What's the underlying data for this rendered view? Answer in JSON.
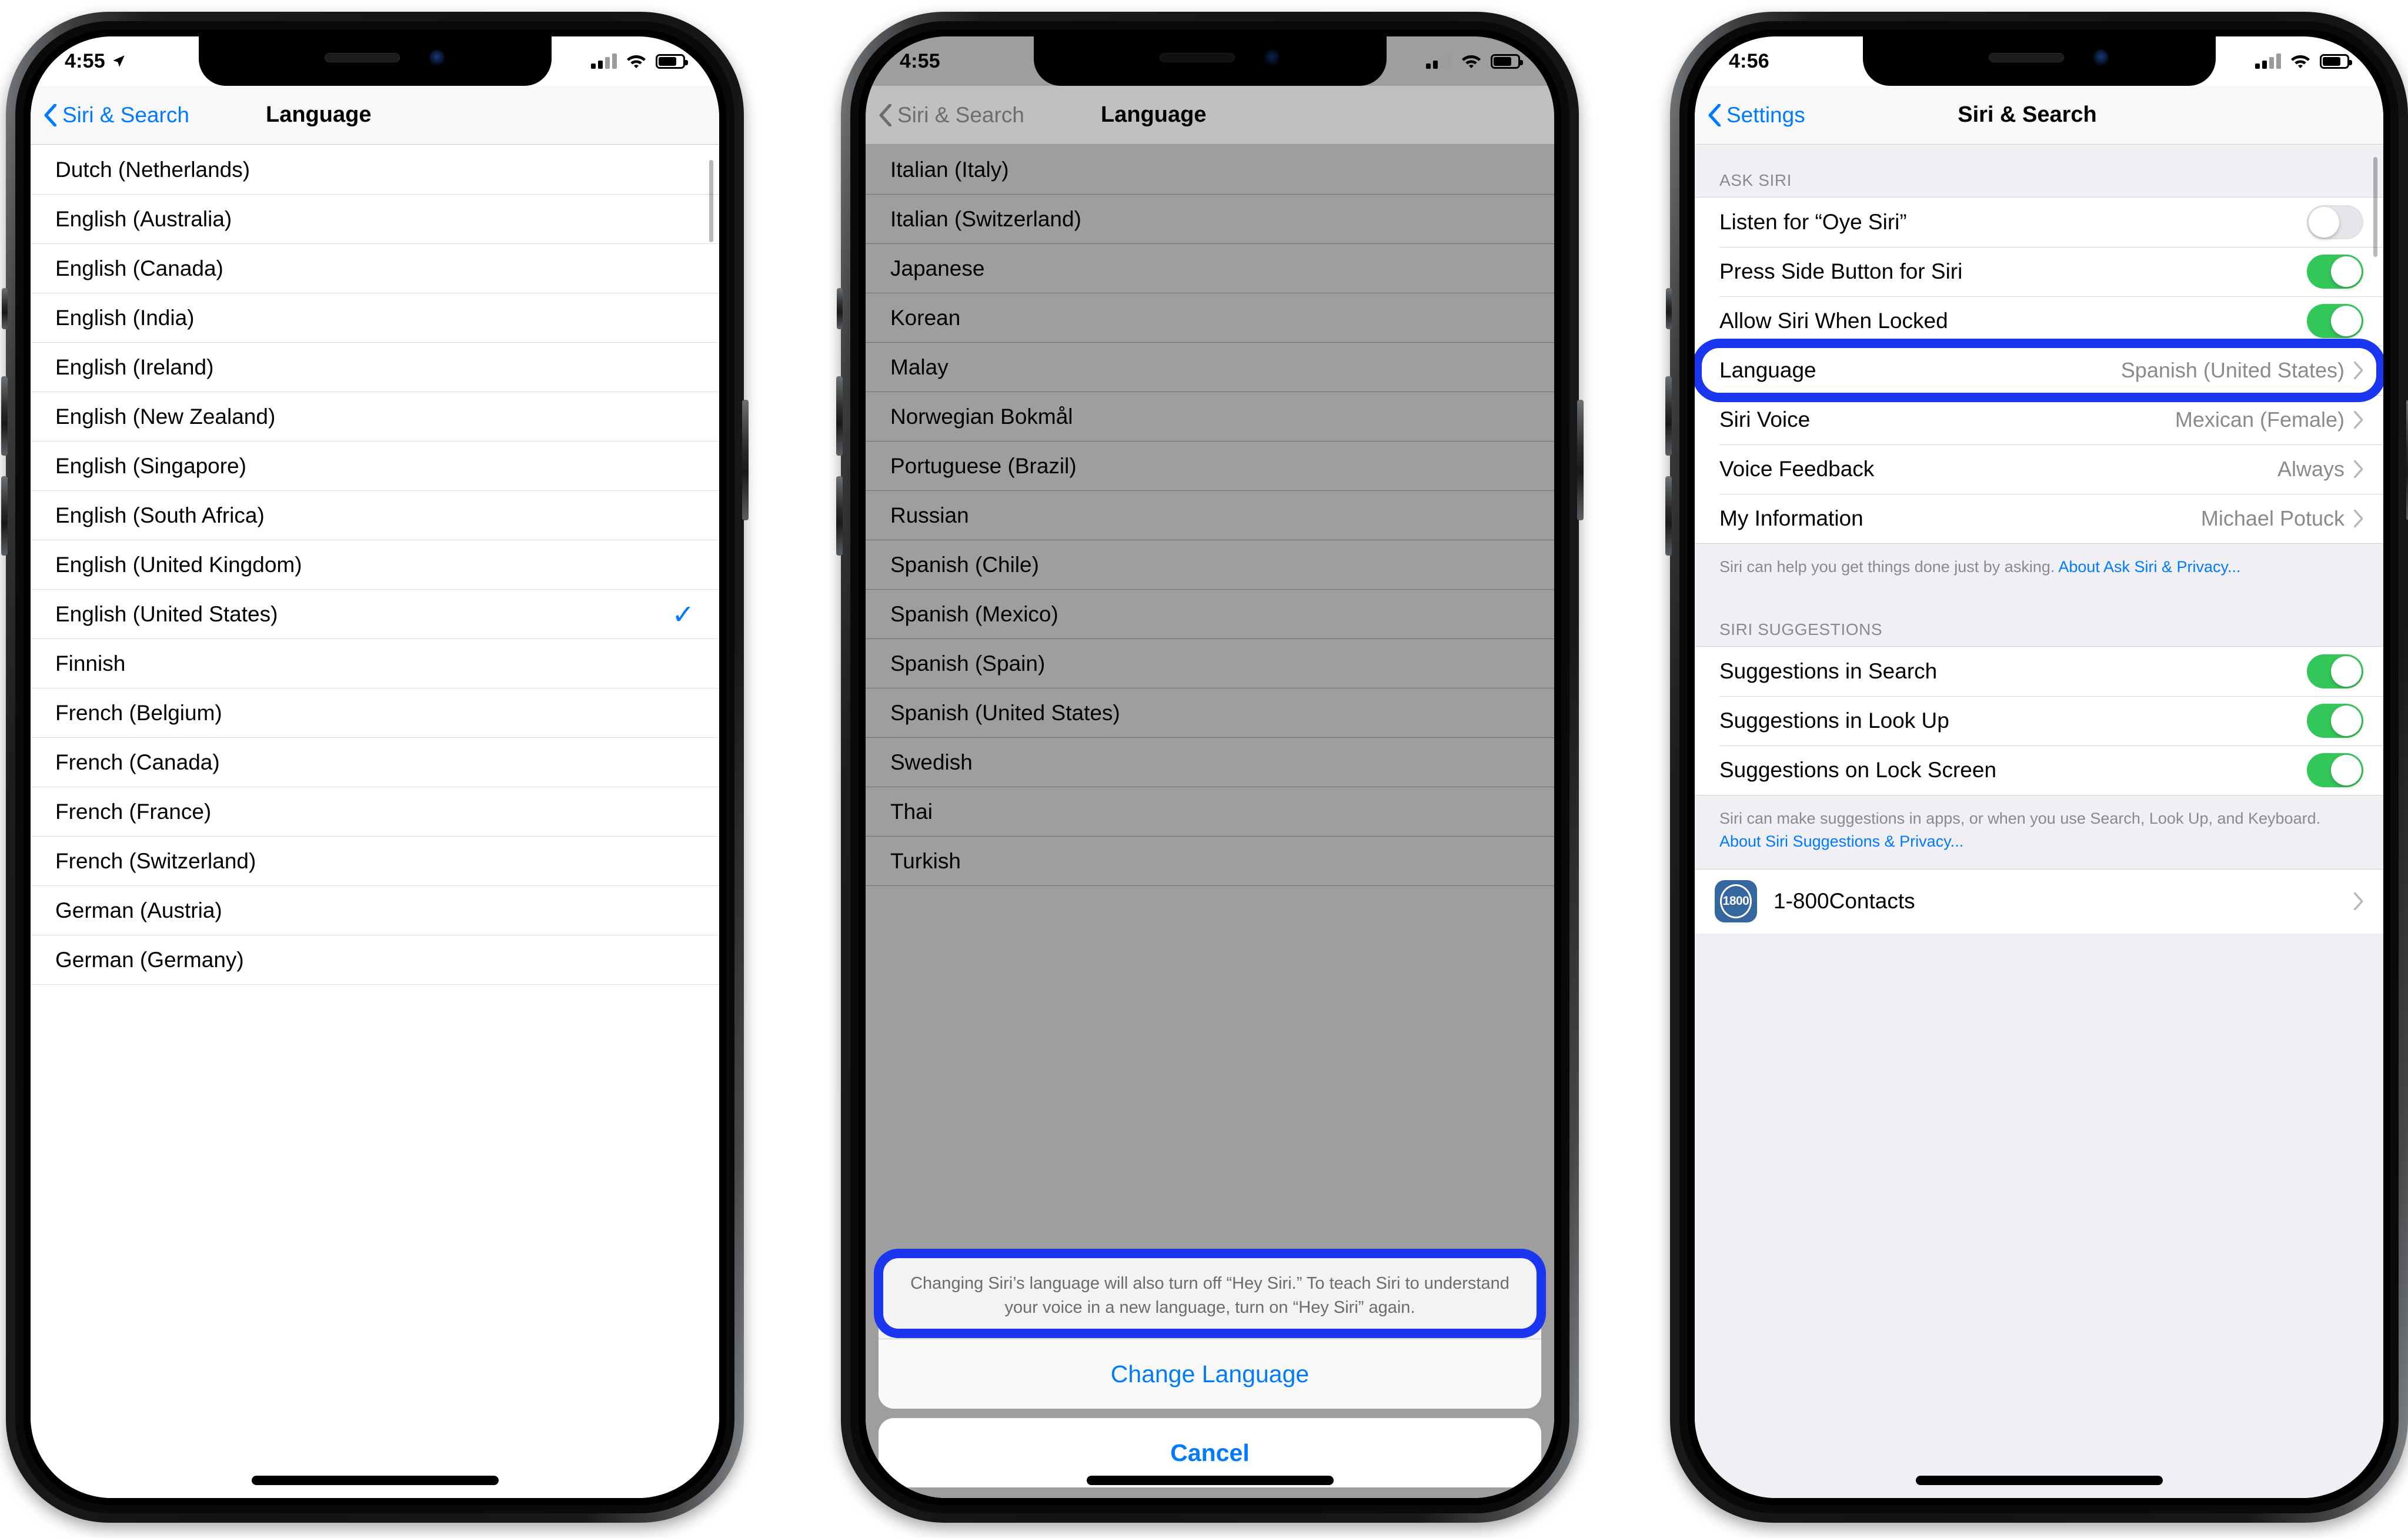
{
  "phone1": {
    "status": {
      "time": "4:55",
      "location_icon": "location-arrow-icon",
      "signal_icon": "cellular-bars-icon",
      "wifi_icon": "wifi-icon",
      "battery_icon": "battery-icon"
    },
    "nav": {
      "back_label": "Siri & Search",
      "title": "Language"
    },
    "languages": [
      {
        "name": "Dutch (Netherlands)",
        "selected": false
      },
      {
        "name": "English (Australia)",
        "selected": false
      },
      {
        "name": "English (Canada)",
        "selected": false
      },
      {
        "name": "English (India)",
        "selected": false
      },
      {
        "name": "English (Ireland)",
        "selected": false
      },
      {
        "name": "English (New Zealand)",
        "selected": false
      },
      {
        "name": "English (Singapore)",
        "selected": false
      },
      {
        "name": "English (South Africa)",
        "selected": false
      },
      {
        "name": "English (United Kingdom)",
        "selected": false
      },
      {
        "name": "English (United States)",
        "selected": true
      },
      {
        "name": "Finnish",
        "selected": false
      },
      {
        "name": "French (Belgium)",
        "selected": false
      },
      {
        "name": "French (Canada)",
        "selected": false
      },
      {
        "name": "French (France)",
        "selected": false
      },
      {
        "name": "French (Switzerland)",
        "selected": false
      },
      {
        "name": "German (Austria)",
        "selected": false
      },
      {
        "name": "German (Germany)",
        "selected": false
      }
    ],
    "checkmark_glyph": "✓"
  },
  "phone2": {
    "status": {
      "time": "4:55"
    },
    "nav": {
      "back_label": "Siri & Search",
      "title": "Language"
    },
    "languages": [
      {
        "name": "Italian (Italy)"
      },
      {
        "name": "Italian (Switzerland)"
      },
      {
        "name": "Japanese"
      },
      {
        "name": "Korean"
      },
      {
        "name": "Malay"
      },
      {
        "name": "Norwegian Bokmål"
      },
      {
        "name": "Portuguese (Brazil)"
      },
      {
        "name": "Russian"
      },
      {
        "name": "Spanish (Chile)"
      },
      {
        "name": "Spanish (Mexico)"
      },
      {
        "name": "Spanish (Spain)"
      },
      {
        "name": "Spanish (United States)"
      },
      {
        "name": "Swedish"
      },
      {
        "name": "Thai"
      },
      {
        "name": "Turkish"
      }
    ],
    "action_sheet": {
      "message": "Changing Siri’s language will also turn off “Hey Siri.” To teach Siri to understand your voice in a new language, turn on “Hey Siri” again.",
      "confirm_label": "Change Language",
      "cancel_label": "Cancel"
    }
  },
  "phone3": {
    "status": {
      "time": "4:56"
    },
    "nav": {
      "back_label": "Settings",
      "title": "Siri & Search"
    },
    "ask_siri": {
      "header": "ASK SIRI",
      "rows": [
        {
          "label": "Listen for “Oye Siri”",
          "type": "toggle",
          "on": false
        },
        {
          "label": "Press Side Button for Siri",
          "type": "toggle",
          "on": true
        },
        {
          "label": "Allow Siri When Locked",
          "type": "toggle",
          "on": true
        },
        {
          "label": "Language",
          "type": "value",
          "value": "Spanish (United States)",
          "highlighted": true
        },
        {
          "label": "Siri Voice",
          "type": "value",
          "value": "Mexican (Female)"
        },
        {
          "label": "Voice Feedback",
          "type": "value",
          "value": "Always"
        },
        {
          "label": "My Information",
          "type": "value",
          "value": "Michael Potuck"
        }
      ],
      "footer_text": "Siri can help you get things done just by asking. ",
      "footer_link": "About Ask Siri & Privacy..."
    },
    "siri_suggestions": {
      "header": "SIRI SUGGESTIONS",
      "rows": [
        {
          "label": "Suggestions in Search",
          "type": "toggle",
          "on": true
        },
        {
          "label": "Suggestions in Look Up",
          "type": "toggle",
          "on": true
        },
        {
          "label": "Suggestions on Lock Screen",
          "type": "toggle",
          "on": true
        }
      ],
      "footer_text": "Siri can make suggestions in apps, or when you use Search, Look Up, and Keyboard. ",
      "footer_link": "About Siri Suggestions & Privacy..."
    },
    "apps": [
      {
        "name": "1-800Contacts",
        "icon_text": "1800"
      }
    ]
  },
  "colors": {
    "accent_blue": "#007aff",
    "highlight_blue": "#1a36f0",
    "toggle_green": "#34c759",
    "group_bg": "#efeff4",
    "secondary_text": "#8a8a8e"
  }
}
